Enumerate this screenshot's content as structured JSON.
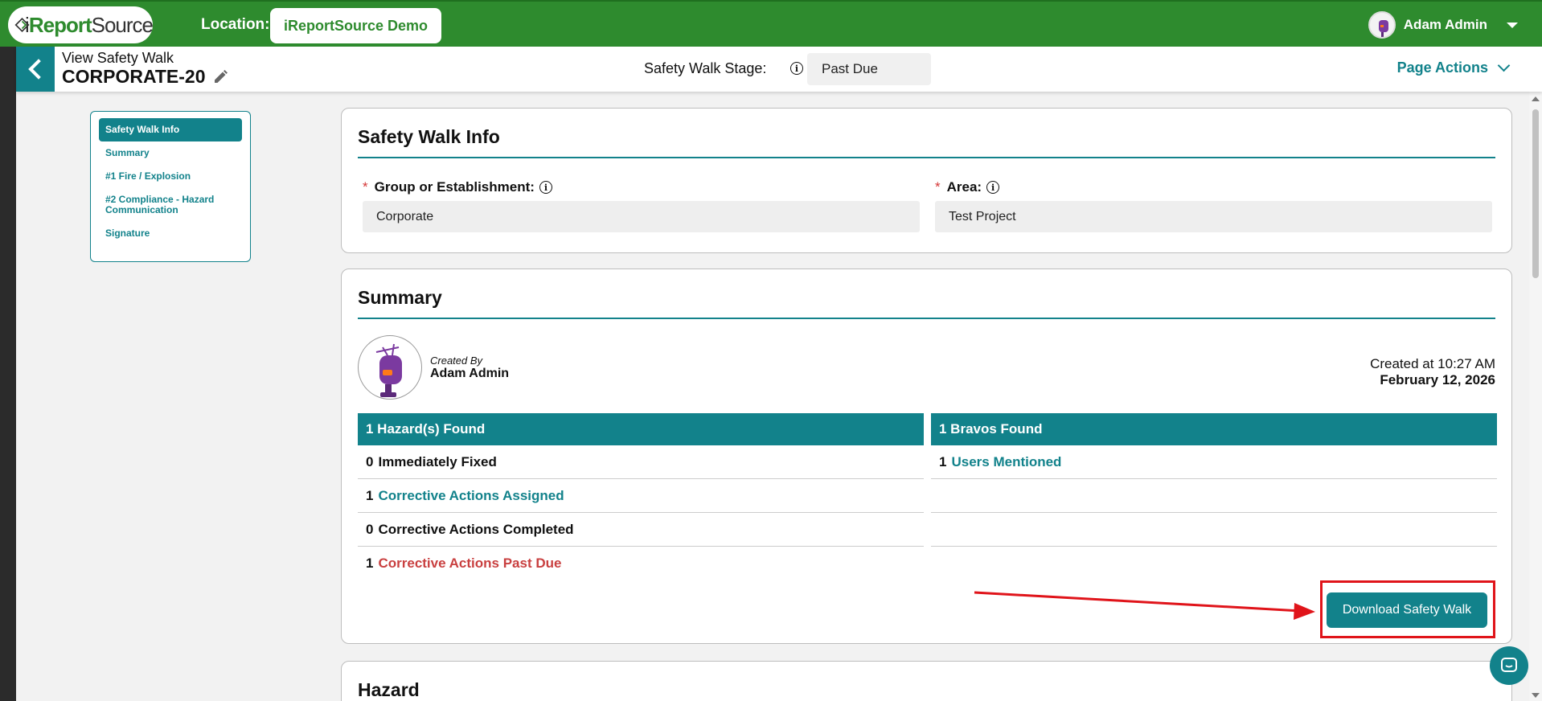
{
  "header": {
    "logo_text_i": "i",
    "logo_text_report": "Report",
    "logo_text_source": "Source",
    "location_label": "Location:",
    "location_value": "iReportSource Demo",
    "user_name": "Adam Admin"
  },
  "subheader": {
    "view_label": "View Safety Walk",
    "record_id": "CORPORATE-20",
    "stage_label": "Safety Walk Stage:",
    "stage_value": "Past Due",
    "page_actions": "Page Actions"
  },
  "sidenav": {
    "items": [
      {
        "label": "Safety Walk Info"
      },
      {
        "label": "Summary"
      },
      {
        "label": "#1 Fire / Explosion"
      },
      {
        "label": "#2 Compliance - Hazard Communication"
      },
      {
        "label": "Signature"
      }
    ]
  },
  "info_card": {
    "title": "Safety Walk Info",
    "group_label": "Group or Establishment:",
    "group_value": "Corporate",
    "area_label": "Area:",
    "area_value": "Test Project",
    "required_mark": "*"
  },
  "summary": {
    "title": "Summary",
    "created_by_label": "Created By",
    "created_by_name": "Adam Admin",
    "created_at": "Created at 10:27 AM",
    "created_date": "February 12, 2026",
    "hazards_header": "1 Hazard(s) Found",
    "bravos_header": "1 Bravos Found",
    "hazard_rows": [
      {
        "num": "0",
        "label": "Immediately Fixed"
      },
      {
        "num": "1",
        "label": "Corrective Actions Assigned"
      },
      {
        "num": "0",
        "label": "Corrective Actions Completed"
      },
      {
        "num": "1",
        "label": "Corrective Actions Past Due"
      }
    ],
    "bravo_rows": [
      {
        "num": "1",
        "label": "Users Mentioned"
      }
    ],
    "download_button": "Download Safety Walk"
  },
  "hazard_card": {
    "title": "Hazard"
  },
  "colors": {
    "brand_green": "#2e8b2e",
    "teal": "#12828b",
    "past_due_red": "#c94040",
    "highlight_red": "#e0141a"
  }
}
